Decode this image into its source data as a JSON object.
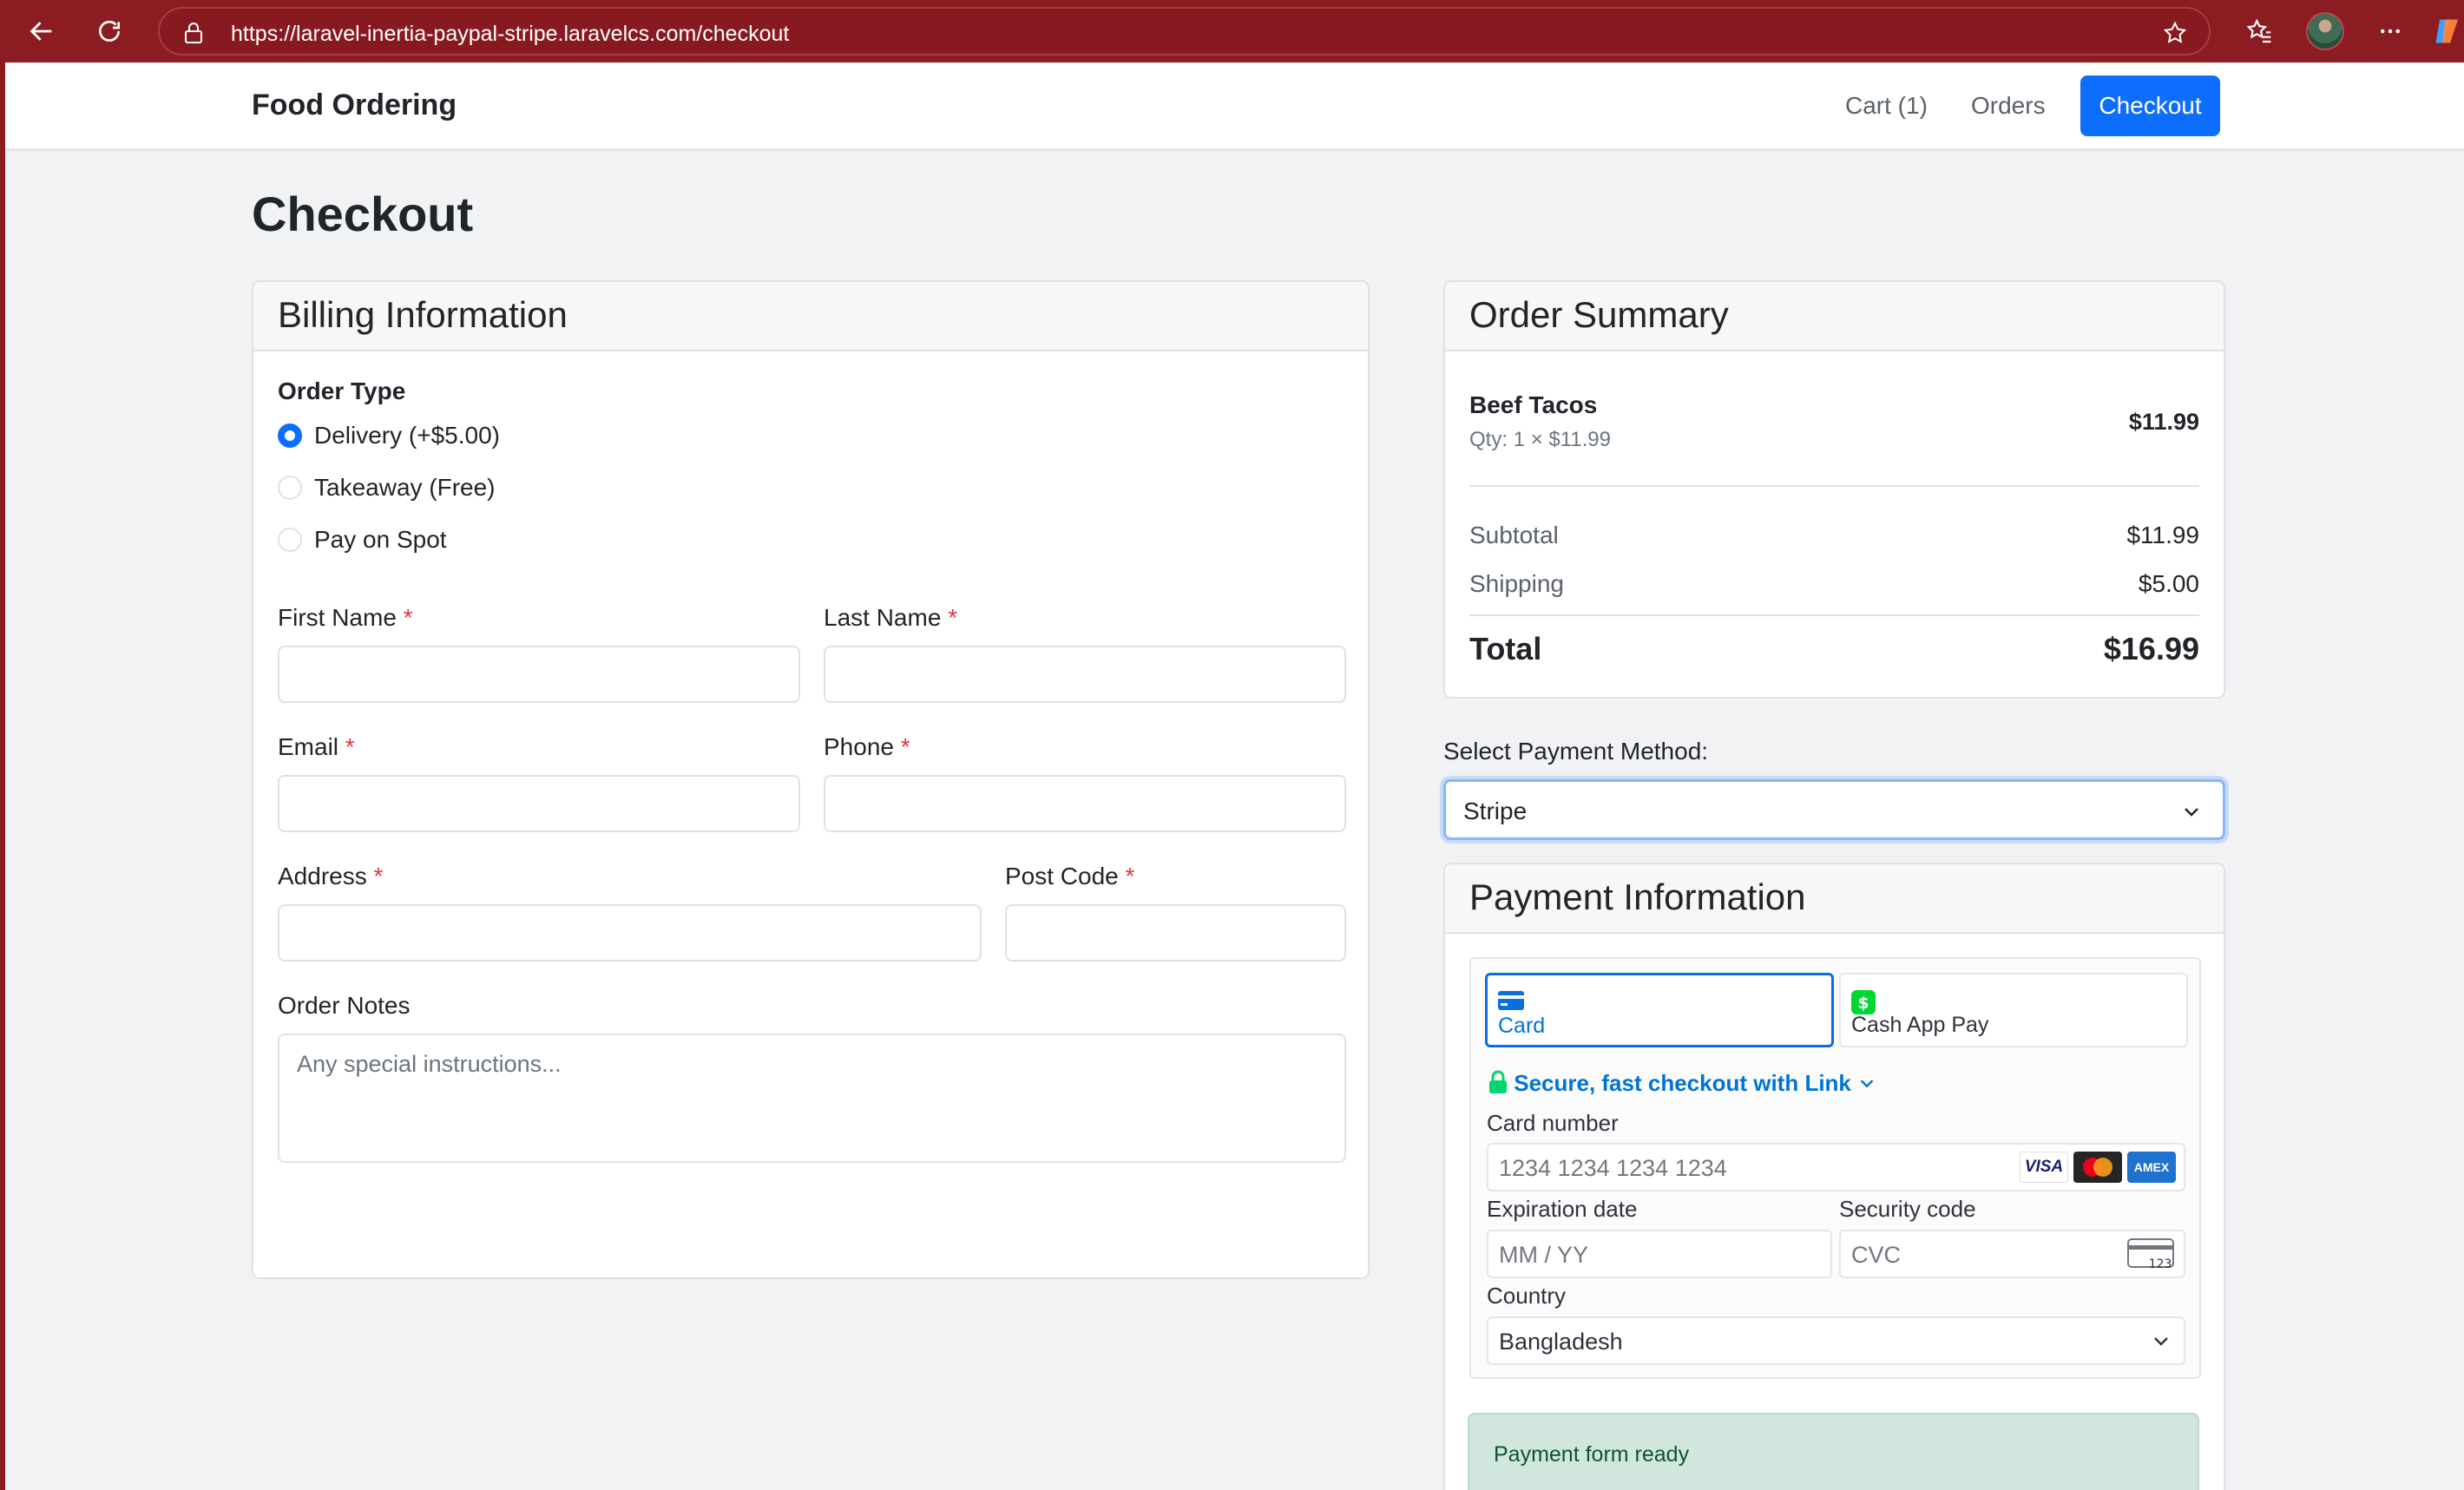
{
  "browser": {
    "url": "https://laravel-inertia-paypal-stripe.laravelcs.com/checkout"
  },
  "navbar": {
    "brand": "Food Ordering",
    "cart_label": "Cart (1)",
    "orders_label": "Orders",
    "checkout_label": "Checkout"
  },
  "page": {
    "title": "Checkout"
  },
  "billing": {
    "header": "Billing Information",
    "order_type_label": "Order Type",
    "order_types": [
      {
        "label": "Delivery (+$5.00)",
        "checked": true
      },
      {
        "label": "Takeaway (Free)",
        "checked": false
      },
      {
        "label": "Pay on Spot",
        "checked": false
      }
    ],
    "first_name_label": "First Name",
    "last_name_label": "Last Name",
    "email_label": "Email",
    "phone_label": "Phone",
    "address_label": "Address",
    "post_code_label": "Post Code",
    "required_mark": "*",
    "order_notes_label": "Order Notes",
    "order_notes_placeholder": "Any special instructions..."
  },
  "summary": {
    "header": "Order Summary",
    "item_name": "Beef Tacos",
    "item_qty": "Qty: 1 × $11.99",
    "item_price": "$11.99",
    "subtotal_label": "Subtotal",
    "subtotal_value": "$11.99",
    "shipping_label": "Shipping",
    "shipping_value": "$5.00",
    "total_label": "Total",
    "total_value": "$16.99"
  },
  "payment_method": {
    "label": "Select Payment Method:",
    "selected": "Stripe"
  },
  "payment_info": {
    "header": "Payment Information",
    "tabs": [
      {
        "label": "Card",
        "icon": "card-icon",
        "active": true
      },
      {
        "label": "Cash App Pay",
        "icon": "cash-app-icon",
        "active": false
      }
    ],
    "link_text": "Secure, fast checkout with Link",
    "card_number_label": "Card number",
    "card_number_placeholder": "1234 1234 1234 1234",
    "card_brands": [
      "VISA",
      "MC",
      "AMEX"
    ],
    "expiry_label": "Expiration date",
    "expiry_placeholder": "MM / YY",
    "cvc_label": "Security code",
    "cvc_placeholder": "CVC",
    "cvc_icon_text": "123",
    "country_label": "Country",
    "country_value": "Bangladesh"
  },
  "status": {
    "message": "Payment form ready"
  },
  "colors": {
    "primary": "#0d6efd",
    "browser_frame": "#8b1c22",
    "success_bg": "#d1e7dd",
    "link_green": "#0074d4"
  }
}
